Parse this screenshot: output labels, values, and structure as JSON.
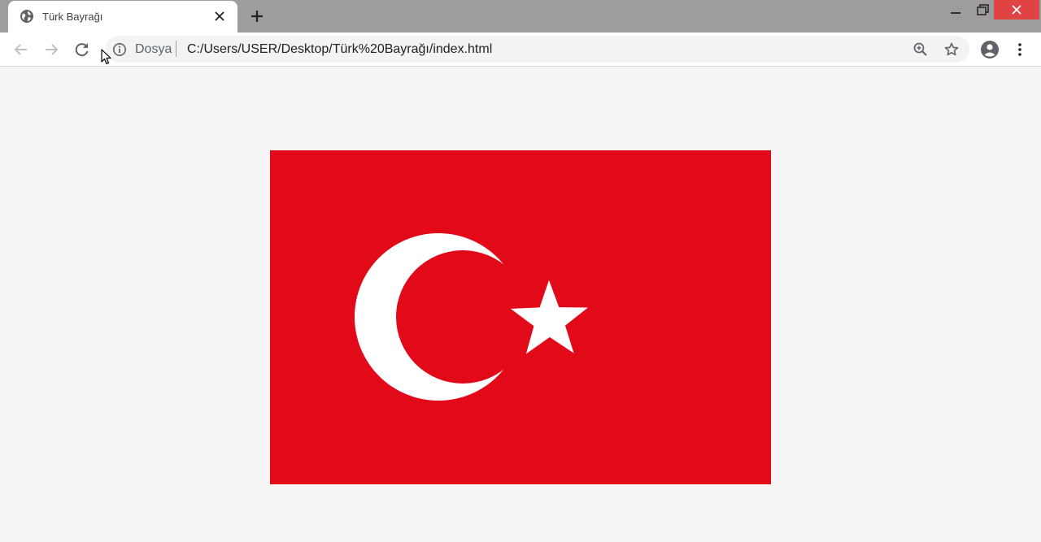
{
  "browser": {
    "tab": {
      "title": "Türk Bayrağı",
      "favicon": "globe-icon"
    },
    "window_controls": [
      "minimize-icon",
      "maximize-icon",
      "close-icon"
    ],
    "toolbar": {
      "back": "arrow-left-icon",
      "forward": "arrow-right-icon",
      "reload": "reload-icon",
      "site_info": "info-icon",
      "url_scheme_label": "Dosya",
      "url": "C:/Users/USER/Desktop/Türk%20Bayrağı/index.html",
      "zoom": "zoom-in-icon",
      "bookmark": "star-icon",
      "profile": "account-icon",
      "menu": "more-vert-icon"
    }
  },
  "page": {
    "flag": {
      "country": "Turkey",
      "background_color": "#e20a19",
      "emblem_color": "#ffffff",
      "elements": [
        "crescent",
        "star"
      ]
    },
    "background_color": "#f5f5f5"
  }
}
